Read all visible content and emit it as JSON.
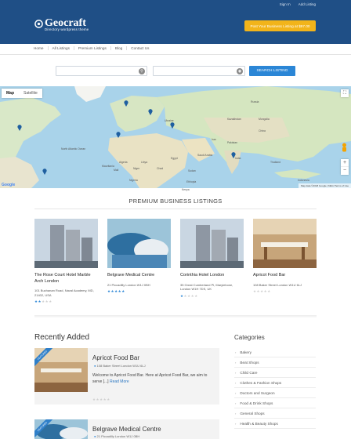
{
  "top_links": [
    "Sign In",
    "Add Listing"
  ],
  "brand": {
    "name": "Geocraft",
    "tagline": "Directory wordpress theme"
  },
  "post_button": "Post Your Business Listing at $97.00",
  "nav": [
    "Home",
    "All Listings",
    "Premium Listings",
    "Blog",
    "Contact Us"
  ],
  "search": {
    "button": "SEARCH LISTING"
  },
  "map": {
    "tabs": [
      "Map",
      "Satellite"
    ],
    "zoom_in": "+",
    "zoom_out": "−",
    "credit": "Map data ©2018 Google, INEGI   Terms of Use",
    "google": "Google",
    "labels": [
      "North Atlantic Ocean",
      "Niger",
      "Chad",
      "Sudan",
      "Libya",
      "Egypt",
      "Algeria",
      "Mali",
      "Mauritania",
      "Nigeria",
      "Ethiopia",
      "Kenya",
      "Saudi Arabia",
      "Iran",
      "Pakistan",
      "India",
      "China",
      "Mongolia",
      "Kazakhstan",
      "Russia",
      "Thailand",
      "Indonesia",
      "Ukraine"
    ]
  },
  "premium": {
    "title": "PREMIUM BUSINESS LISTINGS",
    "cards": [
      {
        "name": "The Rose Court Hotel Marble Arch London",
        "address": "101 Buchanan Road, Naval Academy, MD, 21402, USA",
        "rating": 2,
        "star_color": "#2b86d6"
      },
      {
        "name": "Belgrave Medical Centre",
        "address": "21 Piccadilly London W1J 0BH",
        "rating": 5,
        "star_color": "#2b86d6"
      },
      {
        "name": "Corinthia Hotel London",
        "address": "35 Great Cumberland Pl, Marylebone, London W1H 7DS, UK",
        "rating": 1,
        "star_color": "#2b86d6"
      },
      {
        "name": "Apricot Food Bar",
        "address": "108 Baker Street London W1U 6LJ",
        "rating": 0,
        "star_color": "#2b86d6"
      }
    ]
  },
  "recent": {
    "title": "Recently Added",
    "items": [
      {
        "ribbon": "FEATURED",
        "title": "Apricot Food Bar",
        "address": "108 Baker Street London W1U 6LJ",
        "desc": "Welcome to Apricot Food Bar. Here at Apricot Food Bar, we aim to serve [...]",
        "more": "Read More",
        "rating": 0
      },
      {
        "ribbon": "FEATURED",
        "title": "Belgrave Medical Centre",
        "address": "21 Piccadilly London W1J 0BH"
      }
    ]
  },
  "categories": {
    "title": "Categories",
    "items": [
      "Bakery",
      "Beat Shops",
      "Child Care",
      "Clothes & Fashion Shops",
      "Doctors and Surgeon",
      "Food & Drink Shops",
      "General Shops",
      "Health & Beauty Shops"
    ]
  },
  "colors": {
    "header": "#1f4f86",
    "accent": "#f2b41a",
    "link": "#2b86d6"
  }
}
